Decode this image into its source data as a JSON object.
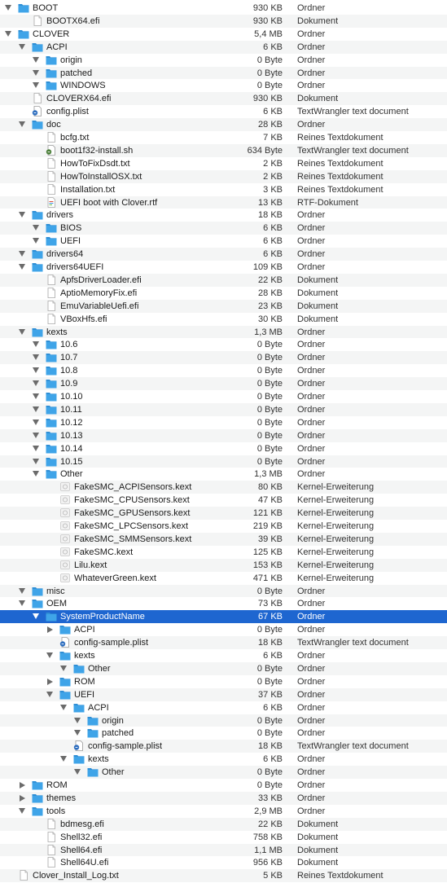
{
  "files": [
    {
      "d": 0,
      "t": "folder",
      "open": true,
      "name": "BOOT",
      "size": "930 KB",
      "kind": "Ordner"
    },
    {
      "d": 1,
      "t": "doc",
      "name": "BOOTX64.efi",
      "size": "930 KB",
      "kind": "Dokument"
    },
    {
      "d": 0,
      "t": "folder",
      "open": true,
      "name": "CLOVER",
      "size": "5,4 MB",
      "kind": "Ordner"
    },
    {
      "d": 1,
      "t": "folder",
      "open": true,
      "name": "ACPI",
      "size": "6 KB",
      "kind": "Ordner"
    },
    {
      "d": 2,
      "t": "folder",
      "open": true,
      "name": "origin",
      "size": "0 Byte",
      "kind": "Ordner"
    },
    {
      "d": 2,
      "t": "folder",
      "open": true,
      "name": "patched",
      "size": "0 Byte",
      "kind": "Ordner"
    },
    {
      "d": 2,
      "t": "folder",
      "open": true,
      "name": "WINDOWS",
      "size": "0 Byte",
      "kind": "Ordner"
    },
    {
      "d": 1,
      "t": "doc",
      "name": "CLOVERX64.efi",
      "size": "930 KB",
      "kind": "Dokument"
    },
    {
      "d": 1,
      "t": "plist",
      "name": "config.plist",
      "size": "6 KB",
      "kind": "TextWrangler text document"
    },
    {
      "d": 1,
      "t": "folder",
      "open": true,
      "name": "doc",
      "size": "28 KB",
      "kind": "Ordner"
    },
    {
      "d": 2,
      "t": "doc",
      "name": "bcfg.txt",
      "size": "7 KB",
      "kind": "Reines Textdokument"
    },
    {
      "d": 2,
      "t": "script",
      "name": "boot1f32-install.sh",
      "size": "634 Byte",
      "kind": "TextWrangler text document"
    },
    {
      "d": 2,
      "t": "doc",
      "name": "HowToFixDsdt.txt",
      "size": "2 KB",
      "kind": "Reines Textdokument"
    },
    {
      "d": 2,
      "t": "doc",
      "name": "HowToInstallOSX.txt",
      "size": "2 KB",
      "kind": "Reines Textdokument"
    },
    {
      "d": 2,
      "t": "doc",
      "name": "Installation.txt",
      "size": "3 KB",
      "kind": "Reines Textdokument"
    },
    {
      "d": 2,
      "t": "rtf",
      "name": "UEFI boot with Clover.rtf",
      "size": "13 KB",
      "kind": "RTF-Dokument"
    },
    {
      "d": 1,
      "t": "folder",
      "open": true,
      "name": "drivers",
      "size": "18 KB",
      "kind": "Ordner"
    },
    {
      "d": 2,
      "t": "folder",
      "open": true,
      "name": "BIOS",
      "size": "6 KB",
      "kind": "Ordner"
    },
    {
      "d": 2,
      "t": "folder",
      "open": true,
      "name": "UEFI",
      "size": "6 KB",
      "kind": "Ordner"
    },
    {
      "d": 1,
      "t": "folder",
      "open": true,
      "name": "drivers64",
      "size": "6 KB",
      "kind": "Ordner"
    },
    {
      "d": 1,
      "t": "folder",
      "open": true,
      "name": "drivers64UEFI",
      "size": "109 KB",
      "kind": "Ordner"
    },
    {
      "d": 2,
      "t": "doc",
      "name": "ApfsDriverLoader.efi",
      "size": "22 KB",
      "kind": "Dokument"
    },
    {
      "d": 2,
      "t": "doc",
      "name": "AptioMemoryFix.efi",
      "size": "28 KB",
      "kind": "Dokument"
    },
    {
      "d": 2,
      "t": "doc",
      "name": "EmuVariableUefi.efi",
      "size": "23 KB",
      "kind": "Dokument"
    },
    {
      "d": 2,
      "t": "doc",
      "name": "VBoxHfs.efi",
      "size": "30 KB",
      "kind": "Dokument"
    },
    {
      "d": 1,
      "t": "folder",
      "open": true,
      "name": "kexts",
      "size": "1,3 MB",
      "kind": "Ordner"
    },
    {
      "d": 2,
      "t": "folder",
      "open": true,
      "name": "10.6",
      "size": "0 Byte",
      "kind": "Ordner"
    },
    {
      "d": 2,
      "t": "folder",
      "open": true,
      "name": "10.7",
      "size": "0 Byte",
      "kind": "Ordner"
    },
    {
      "d": 2,
      "t": "folder",
      "open": true,
      "name": "10.8",
      "size": "0 Byte",
      "kind": "Ordner"
    },
    {
      "d": 2,
      "t": "folder",
      "open": true,
      "name": "10.9",
      "size": "0 Byte",
      "kind": "Ordner"
    },
    {
      "d": 2,
      "t": "folder",
      "open": true,
      "name": "10.10",
      "size": "0 Byte",
      "kind": "Ordner"
    },
    {
      "d": 2,
      "t": "folder",
      "open": true,
      "name": "10.11",
      "size": "0 Byte",
      "kind": "Ordner"
    },
    {
      "d": 2,
      "t": "folder",
      "open": true,
      "name": "10.12",
      "size": "0 Byte",
      "kind": "Ordner"
    },
    {
      "d": 2,
      "t": "folder",
      "open": true,
      "name": "10.13",
      "size": "0 Byte",
      "kind": "Ordner"
    },
    {
      "d": 2,
      "t": "folder",
      "open": true,
      "name": "10.14",
      "size": "0 Byte",
      "kind": "Ordner"
    },
    {
      "d": 2,
      "t": "folder",
      "open": true,
      "name": "10.15",
      "size": "0 Byte",
      "kind": "Ordner"
    },
    {
      "d": 2,
      "t": "folder",
      "open": true,
      "name": "Other",
      "size": "1,3 MB",
      "kind": "Ordner"
    },
    {
      "d": 3,
      "t": "kext",
      "name": "FakeSMC_ACPISensors.kext",
      "size": "80 KB",
      "kind": "Kernel-Erweiterung"
    },
    {
      "d": 3,
      "t": "kext",
      "name": "FakeSMC_CPUSensors.kext",
      "size": "47 KB",
      "kind": "Kernel-Erweiterung"
    },
    {
      "d": 3,
      "t": "kext",
      "name": "FakeSMC_GPUSensors.kext",
      "size": "121 KB",
      "kind": "Kernel-Erweiterung"
    },
    {
      "d": 3,
      "t": "kext",
      "name": "FakeSMC_LPCSensors.kext",
      "size": "219 KB",
      "kind": "Kernel-Erweiterung"
    },
    {
      "d": 3,
      "t": "kext",
      "name": "FakeSMC_SMMSensors.kext",
      "size": "39 KB",
      "kind": "Kernel-Erweiterung"
    },
    {
      "d": 3,
      "t": "kext",
      "name": "FakeSMC.kext",
      "size": "125 KB",
      "kind": "Kernel-Erweiterung"
    },
    {
      "d": 3,
      "t": "kext",
      "name": "Lilu.kext",
      "size": "153 KB",
      "kind": "Kernel-Erweiterung"
    },
    {
      "d": 3,
      "t": "kext",
      "name": "WhateverGreen.kext",
      "size": "471 KB",
      "kind": "Kernel-Erweiterung"
    },
    {
      "d": 1,
      "t": "folder",
      "open": true,
      "name": "misc",
      "size": "0 Byte",
      "kind": "Ordner"
    },
    {
      "d": 1,
      "t": "folder",
      "open": true,
      "name": "OEM",
      "size": "73 KB",
      "kind": "Ordner"
    },
    {
      "d": 2,
      "t": "folder",
      "open": true,
      "sel": true,
      "name": "SystemProductName",
      "size": "67 KB",
      "kind": "Ordner"
    },
    {
      "d": 3,
      "t": "folder",
      "open": false,
      "name": "ACPI",
      "size": "0 Byte",
      "kind": "Ordner"
    },
    {
      "d": 3,
      "t": "plist",
      "name": "config-sample.plist",
      "size": "18 KB",
      "kind": "TextWrangler text document"
    },
    {
      "d": 3,
      "t": "folder",
      "open": true,
      "name": "kexts",
      "size": "6 KB",
      "kind": "Ordner"
    },
    {
      "d": 4,
      "t": "folder",
      "open": true,
      "name": "Other",
      "size": "0 Byte",
      "kind": "Ordner"
    },
    {
      "d": 3,
      "t": "folder",
      "open": false,
      "name": "ROM",
      "size": "0 Byte",
      "kind": "Ordner"
    },
    {
      "d": 3,
      "t": "folder",
      "open": true,
      "name": "UEFI",
      "size": "37 KB",
      "kind": "Ordner"
    },
    {
      "d": 4,
      "t": "folder",
      "open": true,
      "name": "ACPI",
      "size": "6 KB",
      "kind": "Ordner"
    },
    {
      "d": 5,
      "t": "folder",
      "open": true,
      "name": "origin",
      "size": "0 Byte",
      "kind": "Ordner"
    },
    {
      "d": 5,
      "t": "folder",
      "open": true,
      "name": "patched",
      "size": "0 Byte",
      "kind": "Ordner"
    },
    {
      "d": 4,
      "t": "plist",
      "name": "config-sample.plist",
      "size": "18 KB",
      "kind": "TextWrangler text document"
    },
    {
      "d": 4,
      "t": "folder",
      "open": true,
      "name": "kexts",
      "size": "6 KB",
      "kind": "Ordner"
    },
    {
      "d": 5,
      "t": "folder",
      "open": true,
      "name": "Other",
      "size": "0 Byte",
      "kind": "Ordner"
    },
    {
      "d": 1,
      "t": "folder",
      "open": false,
      "name": "ROM",
      "size": "0 Byte",
      "kind": "Ordner"
    },
    {
      "d": 1,
      "t": "folder",
      "open": false,
      "name": "themes",
      "size": "33 KB",
      "kind": "Ordner"
    },
    {
      "d": 1,
      "t": "folder",
      "open": true,
      "name": "tools",
      "size": "2,9 MB",
      "kind": "Ordner"
    },
    {
      "d": 2,
      "t": "doc",
      "name": "bdmesg.efi",
      "size": "22 KB",
      "kind": "Dokument"
    },
    {
      "d": 2,
      "t": "doc",
      "name": "Shell32.efi",
      "size": "758 KB",
      "kind": "Dokument"
    },
    {
      "d": 2,
      "t": "doc",
      "name": "Shell64.efi",
      "size": "1,1 MB",
      "kind": "Dokument"
    },
    {
      "d": 2,
      "t": "doc",
      "name": "Shell64U.efi",
      "size": "956 KB",
      "kind": "Dokument"
    },
    {
      "d": 0,
      "t": "doc",
      "name": "Clover_Install_Log.txt",
      "size": "5 KB",
      "kind": "Reines Textdokument"
    }
  ],
  "colors": {
    "folder": "#3fa4e8",
    "folder_tab": "#2f8fd6",
    "selection": "#1e66d0",
    "row_alt": "#f4f5f5"
  }
}
